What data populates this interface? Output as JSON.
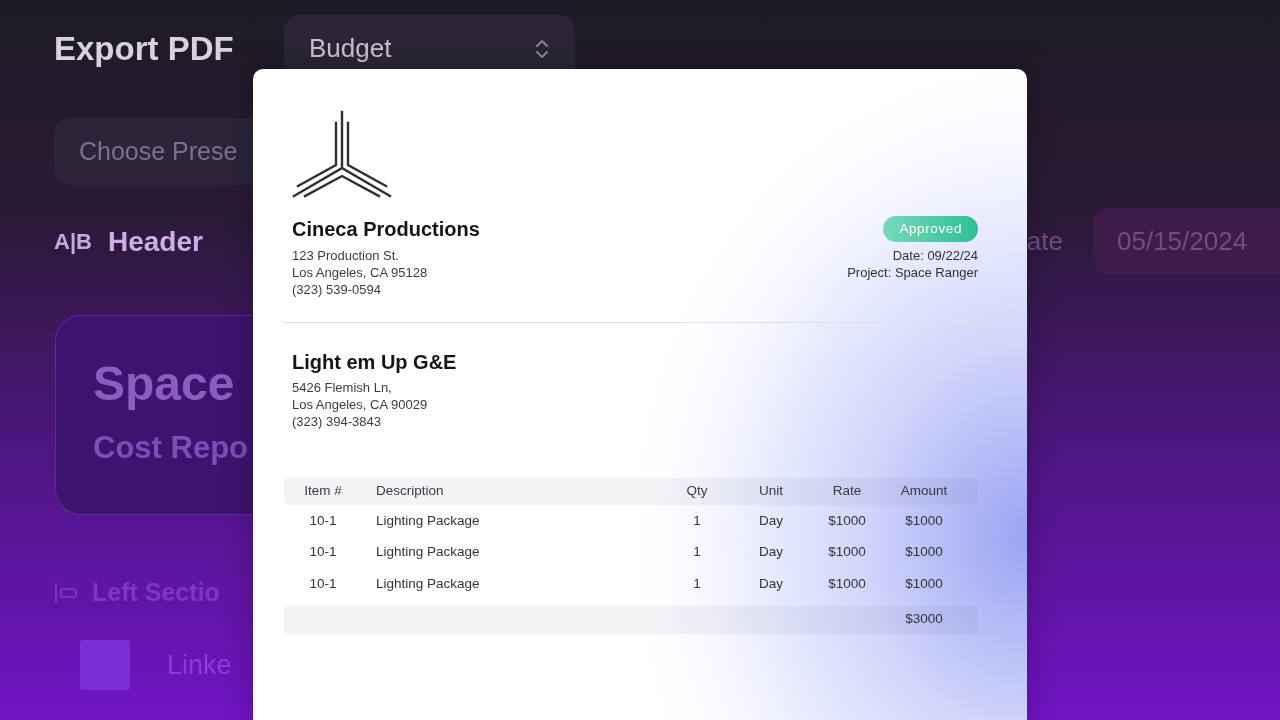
{
  "background": {
    "title": "Export PDF",
    "template_select": {
      "value": "Budget"
    },
    "preset_field": {
      "placeholder": "Choose Prese"
    },
    "section": {
      "icon_text": "A|B",
      "label": "Header"
    },
    "field": {
      "label": "ate",
      "value": "05/15/2024"
    },
    "title_card": {
      "title": "Space",
      "subtitle": "Cost Repo"
    },
    "left_section": {
      "label": "Left Sectio"
    },
    "linked_item": {
      "label": "Linke"
    }
  },
  "document": {
    "sender": {
      "name": "Cineca Productions",
      "address_lines": [
        "123 Production St.",
        "Los Angeles, CA 95128",
        "(323) 539-0594"
      ]
    },
    "status": {
      "label": "Approved"
    },
    "meta_lines": [
      "Date: 09/22/24",
      "Project: Space Ranger"
    ],
    "recipient": {
      "name": "Light em Up G&E",
      "address_lines": [
        "5426 Flemish Ln,",
        "Los Angeles, CA 90029",
        "(323) 394-3843"
      ]
    },
    "table": {
      "columns": [
        "Item #",
        "Description",
        "Qty",
        "Unit",
        "Rate",
        "Amount"
      ],
      "rows": [
        [
          "10-1",
          "Lighting Package",
          "1",
          "Day",
          "$1000",
          "$1000"
        ],
        [
          "10-1",
          "Lighting Package",
          "1",
          "Day",
          "$1000",
          "$1000"
        ],
        [
          "10-1",
          "Lighting Package",
          "1",
          "Day",
          "$1000",
          "$1000"
        ]
      ],
      "total": "$3000"
    }
  }
}
